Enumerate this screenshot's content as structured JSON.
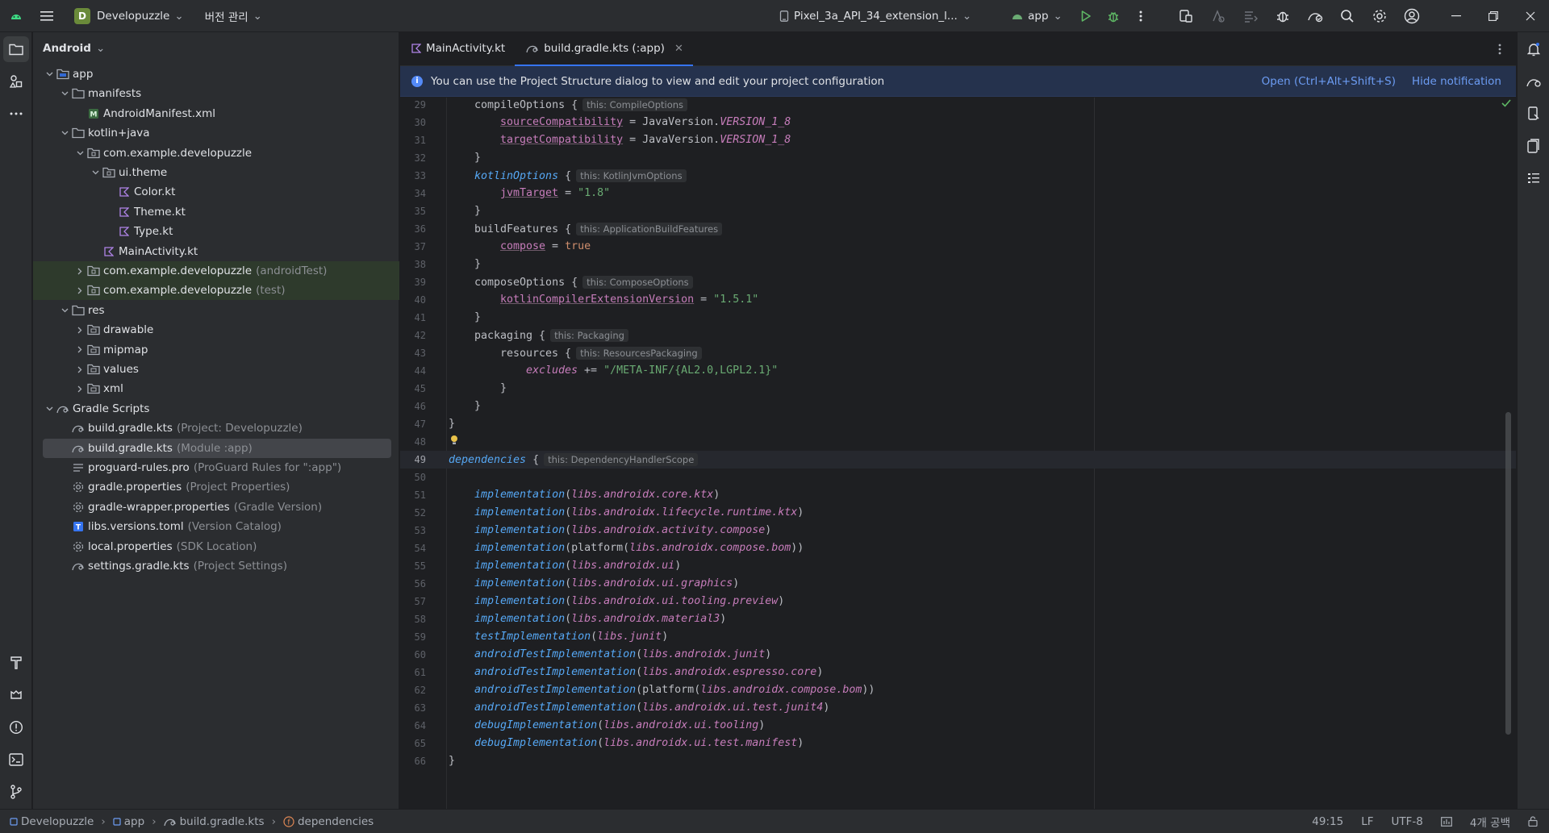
{
  "titlebar": {
    "project_initial": "D",
    "project_name": "Developuzzle",
    "vcs_menu": "버전 관리",
    "device": "Pixel_3a_API_34_extension_l...",
    "run_config": "app"
  },
  "project_panel": {
    "view_mode": "Android",
    "tree": [
      {
        "label": "app",
        "hint": "",
        "depth": 0,
        "arrow": "down",
        "icon": "module-folder-icon",
        "bold": true
      },
      {
        "label": "manifests",
        "hint": "",
        "depth": 1,
        "arrow": "down",
        "icon": "folder-icon"
      },
      {
        "label": "AndroidManifest.xml",
        "hint": "",
        "depth": 2,
        "arrow": "",
        "icon": "manifest-file-icon"
      },
      {
        "label": "kotlin+java",
        "hint": "",
        "depth": 1,
        "arrow": "down",
        "icon": "folder-icon"
      },
      {
        "label": "com.example.developuzzle",
        "hint": "",
        "depth": 2,
        "arrow": "down",
        "icon": "package-icon"
      },
      {
        "label": "ui.theme",
        "hint": "",
        "depth": 3,
        "arrow": "down",
        "icon": "package-icon"
      },
      {
        "label": "Color.kt",
        "hint": "",
        "depth": 4,
        "arrow": "",
        "icon": "kotlin-file-icon"
      },
      {
        "label": "Theme.kt",
        "hint": "",
        "depth": 4,
        "arrow": "",
        "icon": "kotlin-file-icon"
      },
      {
        "label": "Type.kt",
        "hint": "",
        "depth": 4,
        "arrow": "",
        "icon": "kotlin-file-icon"
      },
      {
        "label": "MainActivity.kt",
        "hint": "",
        "depth": 3,
        "arrow": "",
        "icon": "kotlin-file-icon"
      },
      {
        "label": "com.example.developuzzle",
        "hint": "(androidTest)",
        "depth": 2,
        "arrow": "right",
        "icon": "package-icon",
        "test": true
      },
      {
        "label": "com.example.developuzzle",
        "hint": "(test)",
        "depth": 2,
        "arrow": "right",
        "icon": "package-icon",
        "test": true
      },
      {
        "label": "res",
        "hint": "",
        "depth": 1,
        "arrow": "down",
        "icon": "folder-icon"
      },
      {
        "label": "drawable",
        "hint": "",
        "depth": 2,
        "arrow": "right",
        "icon": "res-folder-icon"
      },
      {
        "label": "mipmap",
        "hint": "",
        "depth": 2,
        "arrow": "right",
        "icon": "res-folder-icon"
      },
      {
        "label": "values",
        "hint": "",
        "depth": 2,
        "arrow": "right",
        "icon": "res-folder-icon"
      },
      {
        "label": "xml",
        "hint": "",
        "depth": 2,
        "arrow": "right",
        "icon": "res-folder-icon"
      },
      {
        "label": "Gradle Scripts",
        "hint": "",
        "depth": 0,
        "arrow": "down",
        "icon": "gradle-icon"
      },
      {
        "label": "build.gradle.kts",
        "hint": "(Project: Developuzzle)",
        "depth": 1,
        "arrow": "",
        "icon": "gradle-icon"
      },
      {
        "label": "build.gradle.kts",
        "hint": "(Module :app)",
        "depth": 1,
        "arrow": "",
        "icon": "gradle-icon",
        "selected": true
      },
      {
        "label": "proguard-rules.pro",
        "hint": "(ProGuard Rules for \":app\")",
        "depth": 1,
        "arrow": "",
        "icon": "text-file-icon"
      },
      {
        "label": "gradle.properties",
        "hint": "(Project Properties)",
        "depth": 1,
        "arrow": "",
        "icon": "settings-file-icon"
      },
      {
        "label": "gradle-wrapper.properties",
        "hint": "(Gradle Version)",
        "depth": 1,
        "arrow": "",
        "icon": "settings-file-icon"
      },
      {
        "label": "libs.versions.toml",
        "hint": "(Version Catalog)",
        "depth": 1,
        "arrow": "",
        "icon": "toml-file-icon"
      },
      {
        "label": "local.properties",
        "hint": "(SDK Location)",
        "depth": 1,
        "arrow": "",
        "icon": "settings-file-icon"
      },
      {
        "label": "settings.gradle.kts",
        "hint": "(Project Settings)",
        "depth": 1,
        "arrow": "",
        "icon": "gradle-icon"
      }
    ]
  },
  "editor": {
    "tabs": [
      {
        "label": "MainActivity.kt",
        "icon": "kotlin-file-icon",
        "active": false
      },
      {
        "label": "build.gradle.kts (:app)",
        "icon": "gradle-icon",
        "active": true
      }
    ],
    "notification": {
      "text": "You can use the Project Structure dialog to view and edit your project configuration",
      "open_action": "Open (Ctrl+Alt+Shift+S)",
      "hide_action": "Hide notification"
    },
    "current_line": 49,
    "lines": [
      {
        "n": 29,
        "indent": 1,
        "tokens": [
          [
            "p",
            "compileOptions {"
          ],
          [
            "h",
            "this: CompileOptions"
          ]
        ]
      },
      {
        "n": 30,
        "indent": 2,
        "tokens": [
          [
            "prop",
            "sourceCompatibility"
          ],
          [
            "p",
            " = JavaVersion."
          ],
          [
            "const",
            "VERSION_1_8"
          ]
        ]
      },
      {
        "n": 31,
        "indent": 2,
        "tokens": [
          [
            "prop",
            "targetCompatibility"
          ],
          [
            "p",
            " = JavaVersion."
          ],
          [
            "const",
            "VERSION_1_8"
          ]
        ]
      },
      {
        "n": 32,
        "indent": 1,
        "tokens": [
          [
            "p",
            "}"
          ]
        ]
      },
      {
        "n": 33,
        "indent": 1,
        "tokens": [
          [
            "fn",
            "kotlinOptions"
          ],
          [
            "p",
            " {"
          ],
          [
            "h",
            "this: KotlinJvmOptions"
          ]
        ]
      },
      {
        "n": 34,
        "indent": 2,
        "tokens": [
          [
            "prop",
            "jvmTarget"
          ],
          [
            "p",
            " = "
          ],
          [
            "str",
            "\"1.8\""
          ]
        ]
      },
      {
        "n": 35,
        "indent": 1,
        "tokens": [
          [
            "p",
            "}"
          ]
        ]
      },
      {
        "n": 36,
        "indent": 1,
        "tokens": [
          [
            "p",
            "buildFeatures {"
          ],
          [
            "h",
            "this: ApplicationBuildFeatures"
          ]
        ]
      },
      {
        "n": 37,
        "indent": 2,
        "tokens": [
          [
            "prop",
            "compose"
          ],
          [
            "p",
            " = "
          ],
          [
            "kw",
            "true"
          ]
        ]
      },
      {
        "n": 38,
        "indent": 1,
        "tokens": [
          [
            "p",
            "}"
          ]
        ]
      },
      {
        "n": 39,
        "indent": 1,
        "tokens": [
          [
            "p",
            "composeOptions {"
          ],
          [
            "h",
            "this: ComposeOptions"
          ]
        ]
      },
      {
        "n": 40,
        "indent": 2,
        "tokens": [
          [
            "prop",
            "kotlinCompilerExtensionVersion"
          ],
          [
            "p",
            " = "
          ],
          [
            "str",
            "\"1.5.1\""
          ]
        ]
      },
      {
        "n": 41,
        "indent": 1,
        "tokens": [
          [
            "p",
            "}"
          ]
        ]
      },
      {
        "n": 42,
        "indent": 1,
        "tokens": [
          [
            "p",
            "packaging {"
          ],
          [
            "h",
            "this: Packaging"
          ]
        ]
      },
      {
        "n": 43,
        "indent": 2,
        "tokens": [
          [
            "p",
            "resources {"
          ],
          [
            "h",
            "this: ResourcesPackaging"
          ]
        ]
      },
      {
        "n": 44,
        "indent": 3,
        "tokens": [
          [
            "libp",
            "excludes"
          ],
          [
            "p",
            " += "
          ],
          [
            "str",
            "\"/META-INF/{AL2.0,LGPL2.1}\""
          ]
        ]
      },
      {
        "n": 45,
        "indent": 2,
        "tokens": [
          [
            "p",
            "}"
          ]
        ]
      },
      {
        "n": 46,
        "indent": 1,
        "tokens": [
          [
            "p",
            "}"
          ]
        ]
      },
      {
        "n": 47,
        "indent": 0,
        "tokens": [
          [
            "p",
            "}"
          ]
        ]
      },
      {
        "n": 48,
        "indent": 0,
        "tokens": []
      },
      {
        "n": 49,
        "indent": 0,
        "tokens": [
          [
            "fn",
            "dependencies"
          ],
          [
            "p",
            " {"
          ],
          [
            "h",
            "this: DependencyHandlerScope"
          ]
        ]
      },
      {
        "n": 50,
        "indent": 0,
        "tokens": []
      },
      {
        "n": 51,
        "indent": 1,
        "tokens": [
          [
            "fn",
            "implementation"
          ],
          [
            "p",
            "("
          ],
          [
            "libp",
            "libs.androidx.core.ktx"
          ],
          [
            "p",
            ")"
          ]
        ]
      },
      {
        "n": 52,
        "indent": 1,
        "tokens": [
          [
            "fn",
            "implementation"
          ],
          [
            "p",
            "("
          ],
          [
            "libp",
            "libs.androidx.lifecycle.runtime.ktx"
          ],
          [
            "p",
            ")"
          ]
        ]
      },
      {
        "n": 53,
        "indent": 1,
        "tokens": [
          [
            "fn",
            "implementation"
          ],
          [
            "p",
            "("
          ],
          [
            "libp",
            "libs.androidx.activity.compose"
          ],
          [
            "p",
            ")"
          ]
        ]
      },
      {
        "n": 54,
        "indent": 1,
        "tokens": [
          [
            "fn",
            "implementation"
          ],
          [
            "p",
            "(platform("
          ],
          [
            "libp",
            "libs.androidx.compose.bom"
          ],
          [
            "p",
            "))"
          ]
        ]
      },
      {
        "n": 55,
        "indent": 1,
        "tokens": [
          [
            "fn",
            "implementation"
          ],
          [
            "p",
            "("
          ],
          [
            "libp",
            "libs.androidx.ui"
          ],
          [
            "p",
            ")"
          ]
        ]
      },
      {
        "n": 56,
        "indent": 1,
        "tokens": [
          [
            "fn",
            "implementation"
          ],
          [
            "p",
            "("
          ],
          [
            "libp",
            "libs.androidx.ui.graphics"
          ],
          [
            "p",
            ")"
          ]
        ]
      },
      {
        "n": 57,
        "indent": 1,
        "tokens": [
          [
            "fn",
            "implementation"
          ],
          [
            "p",
            "("
          ],
          [
            "libp",
            "libs.androidx.ui.tooling.preview"
          ],
          [
            "p",
            ")"
          ]
        ]
      },
      {
        "n": 58,
        "indent": 1,
        "tokens": [
          [
            "fn",
            "implementation"
          ],
          [
            "p",
            "("
          ],
          [
            "libp",
            "libs.androidx.material3"
          ],
          [
            "p",
            ")"
          ]
        ]
      },
      {
        "n": 59,
        "indent": 1,
        "tokens": [
          [
            "fn",
            "testImplementation"
          ],
          [
            "p",
            "("
          ],
          [
            "libp",
            "libs.junit"
          ],
          [
            "p",
            ")"
          ]
        ]
      },
      {
        "n": 60,
        "indent": 1,
        "tokens": [
          [
            "fn",
            "androidTestImplementation"
          ],
          [
            "p",
            "("
          ],
          [
            "libp",
            "libs.androidx.junit"
          ],
          [
            "p",
            ")"
          ]
        ]
      },
      {
        "n": 61,
        "indent": 1,
        "tokens": [
          [
            "fn",
            "androidTestImplementation"
          ],
          [
            "p",
            "("
          ],
          [
            "libp",
            "libs.androidx.espresso.core"
          ],
          [
            "p",
            ")"
          ]
        ]
      },
      {
        "n": 62,
        "indent": 1,
        "tokens": [
          [
            "fn",
            "androidTestImplementation"
          ],
          [
            "p",
            "(platform("
          ],
          [
            "libp",
            "libs.androidx.compose.bom"
          ],
          [
            "p",
            "))"
          ]
        ]
      },
      {
        "n": 63,
        "indent": 1,
        "tokens": [
          [
            "fn",
            "androidTestImplementation"
          ],
          [
            "p",
            "("
          ],
          [
            "libp",
            "libs.androidx.ui.test.junit4"
          ],
          [
            "p",
            ")"
          ]
        ]
      },
      {
        "n": 64,
        "indent": 1,
        "tokens": [
          [
            "fn",
            "debugImplementation"
          ],
          [
            "p",
            "("
          ],
          [
            "libp",
            "libs.androidx.ui.tooling"
          ],
          [
            "p",
            ")"
          ]
        ]
      },
      {
        "n": 65,
        "indent": 1,
        "tokens": [
          [
            "fn",
            "debugImplementation"
          ],
          [
            "p",
            "("
          ],
          [
            "libp",
            "libs.androidx.ui.test.manifest"
          ],
          [
            "p",
            ")"
          ]
        ]
      },
      {
        "n": 66,
        "indent": 0,
        "tokens": [
          [
            "p",
            "}"
          ]
        ]
      }
    ]
  },
  "statusbar": {
    "breadcrumbs": [
      {
        "label": "Developuzzle",
        "icon": "module-icon"
      },
      {
        "label": "app",
        "icon": "module-icon"
      },
      {
        "label": "build.gradle.kts",
        "icon": "gradle-icon"
      },
      {
        "label": "dependencies",
        "icon": "function-icon"
      }
    ],
    "position": "49:15",
    "line_separator": "LF",
    "encoding": "UTF-8",
    "indent": "4개 공백"
  },
  "colors": {
    "accent": "#3574f0",
    "keyword": "#cf8e6d",
    "function": "#56a8f5",
    "property": "#c77dbb",
    "string": "#6aab73"
  }
}
